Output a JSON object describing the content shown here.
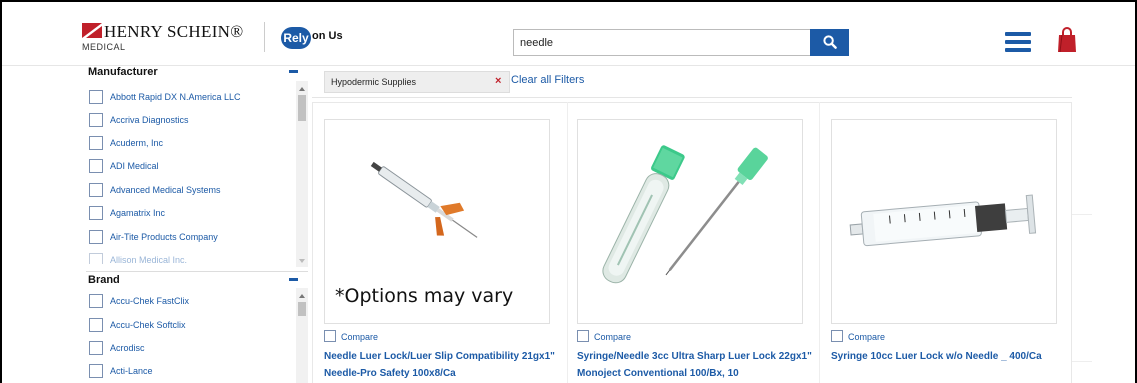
{
  "header": {
    "brand_name": "HENRY SCHEIN®",
    "brand_sub": "MEDICAL",
    "rely_badge": "Rely",
    "rely_text": "on Us",
    "search": {
      "value": "needle"
    }
  },
  "colors": {
    "brand_blue": "#1c5aa6",
    "brand_red": "#c0202a"
  },
  "sidebar": {
    "manufacturer": {
      "title": "Manufacturer",
      "items": [
        "Abbott Rapid DX N.America LLC",
        "Accriva Diagnostics",
        "Acuderm, Inc",
        "ADI Medical",
        "Advanced Medical Systems",
        "Agamatrix Inc",
        "Air-Tite Products Company",
        "Allison Medical Inc."
      ]
    },
    "brand": {
      "title": "Brand",
      "items": [
        "Accu-Chek FastClix",
        "Accu-Chek Softclix",
        "Acrodisc",
        "Acti-Lance"
      ]
    }
  },
  "filters": {
    "active": [
      "Hypodermic Supplies"
    ],
    "remove_icon": "×",
    "clear_all": "Clear all Filters"
  },
  "products": [
    {
      "image_caption": "*Options may vary",
      "compare_label": "Compare",
      "title": "Needle Luer Lock/Luer Slip Compatibility 21gx1\" Needle-Pro Safety 100x8/Ca"
    },
    {
      "compare_label": "Compare",
      "title": "Syringe/Needle 3cc Ultra Sharp Luer Lock 22gx1\" Monoject Conventional 100/Bx, 10"
    },
    {
      "compare_label": "Compare",
      "title": "Syringe 10cc Luer Lock w/o Needle _ 400/Ca"
    }
  ],
  "icons": {
    "search": "search-icon",
    "menu": "hamburger-menu-icon",
    "cart": "shopping-bag-icon"
  }
}
